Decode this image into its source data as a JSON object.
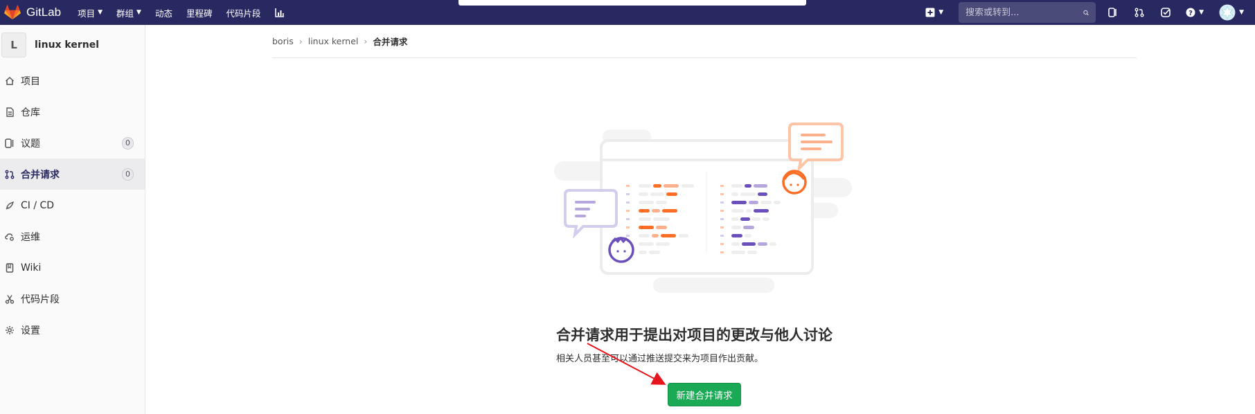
{
  "navbar": {
    "brand": "GitLab",
    "links": [
      {
        "label": "项目",
        "dropdown": true
      },
      {
        "label": "群组",
        "dropdown": true
      },
      {
        "label": "动态",
        "dropdown": false
      },
      {
        "label": "里程碑",
        "dropdown": false
      },
      {
        "label": "代码片段",
        "dropdown": false
      }
    ],
    "search_placeholder": "搜索或转到...",
    "colors": {
      "bg": "#292961",
      "brand_orange": "#fc6d26"
    }
  },
  "sidebar": {
    "avatar_letter": "L",
    "project_name": "linux kernel",
    "items": [
      {
        "label": "项目",
        "icon": "home-icon"
      },
      {
        "label": "仓库",
        "icon": "doc-icon"
      },
      {
        "label": "议题",
        "icon": "issues-icon",
        "count": "0"
      },
      {
        "label": "合并请求",
        "icon": "merge-request-icon",
        "count": "0",
        "active": true
      },
      {
        "label": "CI / CD",
        "icon": "rocket-icon"
      },
      {
        "label": "运维",
        "icon": "cloud-gear-icon"
      },
      {
        "label": "Wiki",
        "icon": "book-icon"
      },
      {
        "label": "代码片段",
        "icon": "scissors-icon"
      },
      {
        "label": "设置",
        "icon": "gear-icon"
      }
    ]
  },
  "breadcrumb": {
    "items": [
      "boris",
      "linux kernel",
      "合并请求"
    ]
  },
  "empty_state": {
    "title": "合并请求用于提出对项目的更改与他人讨论",
    "subtitle": "相关人员甚至可以通过推送提交来为项目作出贡献。",
    "button": "新建合并请求",
    "button_color": "#1aaa55"
  }
}
